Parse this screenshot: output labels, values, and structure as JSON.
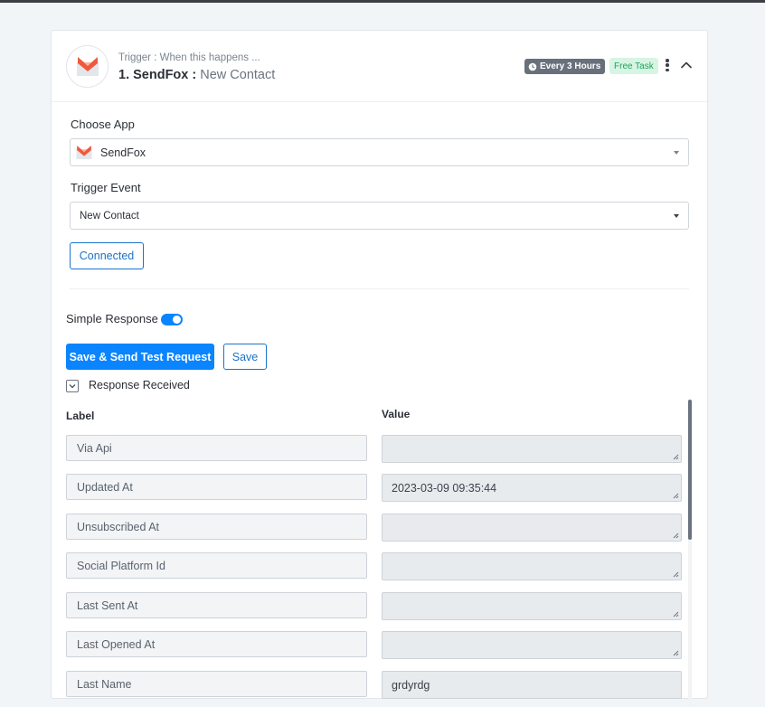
{
  "header": {
    "trigger_sub": "Trigger : When this happens ...",
    "step_title": "1. SendFox :",
    "event_name": "New Contact",
    "schedule_badge": "Every 3 Hours",
    "task_badge": "Free Task"
  },
  "form": {
    "choose_app_label": "Choose App",
    "app_value": "SendFox",
    "trigger_event_label": "Trigger Event",
    "trigger_event_value": "New Contact",
    "connected_label": "Connected"
  },
  "response": {
    "simple_response_label": "Simple Response",
    "simple_response_on": true,
    "save_send_label": "Save & Send Test Request",
    "save_label": "Save",
    "received_label": "Response Received",
    "col_label": "Label",
    "col_value": "Value",
    "rows": [
      {
        "label": "Via Api",
        "value": ""
      },
      {
        "label": "Updated At",
        "value": "2023-03-09 09:35:44"
      },
      {
        "label": "Unsubscribed At",
        "value": ""
      },
      {
        "label": "Social Platform Id",
        "value": ""
      },
      {
        "label": "Last Sent At",
        "value": ""
      },
      {
        "label": "Last Opened At",
        "value": ""
      },
      {
        "label": "Last Name",
        "value": "grdyrdg"
      }
    ]
  },
  "colors": {
    "accent": "#0a84ff",
    "outline": "#1a73c9",
    "badge_grey": "#68707c",
    "badge_green_bg": "#d7f5e4",
    "badge_green_text": "#22a35b"
  },
  "icons": {
    "app_logo": "sendfox-logo",
    "schedule": "clock-icon",
    "menu": "kebab-menu-icon",
    "collapse": "chevron-up-icon",
    "dropdown": "caret-down-icon",
    "checkbox": "chevron-down-icon"
  }
}
